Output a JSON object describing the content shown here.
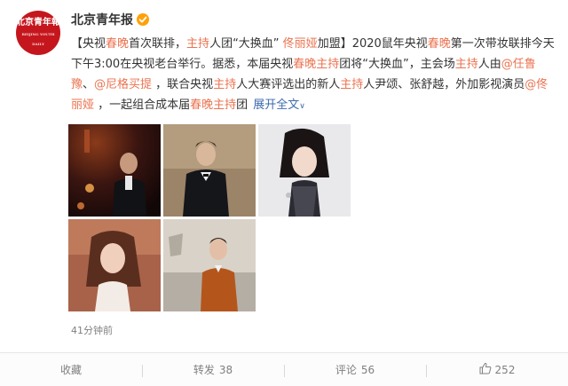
{
  "account": {
    "name": "北京青年报",
    "avatar_text": "北京青年報",
    "avatar_subtext": "BEIJING YOUTH DAILY",
    "verified_color": "#ffa00a"
  },
  "post": {
    "s1": "【央视",
    "s2": "春晚",
    "s3": "首次联排，",
    "s4": "主持",
    "s5": "人团“大换血” ",
    "s6": "佟丽娅",
    "s7": "加盟】2020鼠年央视",
    "s8": "春晚",
    "s9": "第一次带妆联排今天下午3:00在央视老台举行。据悉，本届央视",
    "s10": "春晚主持",
    "s11": "团将“大换血”，主会场",
    "s12": "主持",
    "s13": "人由",
    "s14": "@任鲁豫",
    "s15": "、",
    "s16": "@尼格买提",
    "s17": " ，联合央视",
    "s18": "主持",
    "s19": "人大赛评选出的新人",
    "s20": "主持",
    "s21": "人尹颂、张舒越，外加影视演员",
    "s22": "@佟丽娅",
    "s23": " ，一起组合成本届",
    "s24": "春晚主持",
    "s25": "团",
    "expand": "展开全文",
    "expand_chevron": "∨",
    "timestamp": "41分钟前"
  },
  "actions": {
    "favorite": "收藏",
    "repost_label": "转发",
    "repost_count": "38",
    "comment_label": "评论",
    "comment_count": "56",
    "like_count": "252"
  },
  "colors": {
    "highlight": "#eb7350",
    "link": "#3e6bac",
    "brand_red": "#c5161d"
  }
}
